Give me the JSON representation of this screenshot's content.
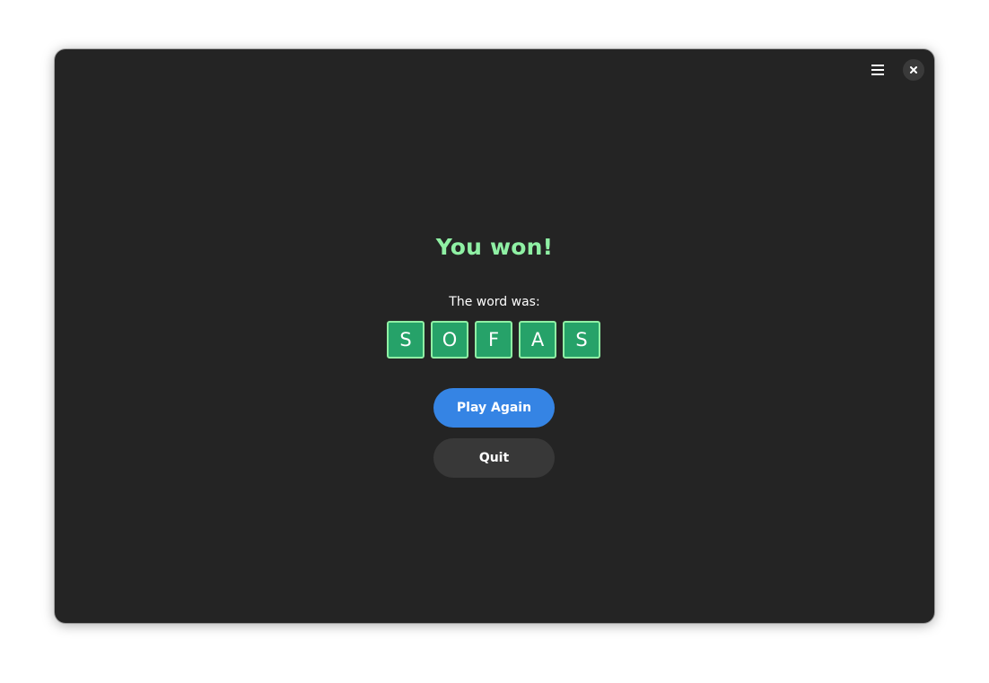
{
  "header": {
    "menu_icon": "hamburger-menu-icon",
    "close_icon": "close-icon"
  },
  "result": {
    "title": "You won!",
    "word_label": "The word was:",
    "letters": [
      "S",
      "O",
      "F",
      "A",
      "S"
    ]
  },
  "actions": {
    "play_again_label": "Play Again",
    "quit_label": "Quit"
  },
  "colors": {
    "window_background": "#242424",
    "title_color": "#8ff0a4",
    "tile_fill": "#26a269",
    "tile_border": "#8ff0a4",
    "primary_button": "#3584e4",
    "secondary_button": "#383838"
  }
}
